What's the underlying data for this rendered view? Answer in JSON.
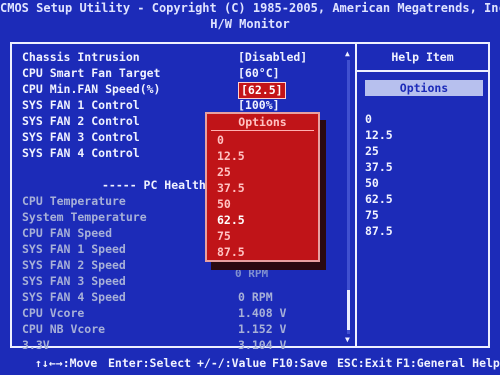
{
  "header": {
    "line1": "CMOS Setup Utility - Copyright (C) 1985-2005, American Megatrends, Inc.",
    "line2": "H/W Monitor"
  },
  "settings": [
    {
      "label": "Chassis Intrusion",
      "value": "[Disabled]",
      "state": "normal"
    },
    {
      "label": "CPU Smart Fan Target",
      "value": "[60°C]",
      "state": "normal"
    },
    {
      "label": "CPU Min.FAN Speed(%)",
      "value": "[62.5]",
      "state": "selected"
    },
    {
      "label": "SYS FAN 1 Control",
      "value": "[100%]",
      "state": "normal"
    },
    {
      "label": "SYS FAN 2 Control",
      "value": "",
      "state": "normal"
    },
    {
      "label": "SYS FAN 3 Control",
      "value": "",
      "state": "normal"
    },
    {
      "label": "SYS FAN 4 Control",
      "value": "",
      "state": "normal"
    }
  ],
  "pc_health": {
    "title": "----- PC Health",
    "items": [
      {
        "label": "CPU Temperature",
        "value": ""
      },
      {
        "label": "System Temperature",
        "value": ""
      },
      {
        "label": "CPU FAN Speed",
        "value": ""
      },
      {
        "label": "SYS FAN 1 Speed",
        "value": ""
      },
      {
        "label": "SYS FAN 2 Speed",
        "value": ""
      },
      {
        "label": "SYS FAN 3 Speed",
        "value": ""
      },
      {
        "label": "SYS FAN 4 Speed",
        "value": "0 RPM"
      },
      {
        "label": "CPU Vcore",
        "value": "1.408 V"
      },
      {
        "label": "CPU NB Vcore",
        "value": "1.152 V"
      },
      {
        "label": "3.3V",
        "value": "3.104 V"
      }
    ]
  },
  "hidden_behind_popup": "0 RPM",
  "popup": {
    "title": "Options",
    "items": [
      "0",
      "12.5",
      "25",
      "37.5",
      "50",
      "62.5",
      "75",
      "87.5"
    ],
    "selected_index": 5
  },
  "help": {
    "title": "Help Item",
    "options_header": "Options",
    "items": [
      "0",
      "12.5",
      "25",
      "37.5",
      "50",
      "62.5",
      "75",
      "87.5"
    ]
  },
  "footer": {
    "move": "↑↓←→:Move",
    "select": "Enter:Select",
    "value": "+/-/:Value",
    "save": "F10:Save",
    "exit": "ESC:Exit",
    "help": "F1:General Help"
  },
  "colors": {
    "background": "#1c2bb8",
    "popup": "#c01418",
    "text": "#f0f2ff",
    "disabled_text": "#a7b0d8"
  }
}
